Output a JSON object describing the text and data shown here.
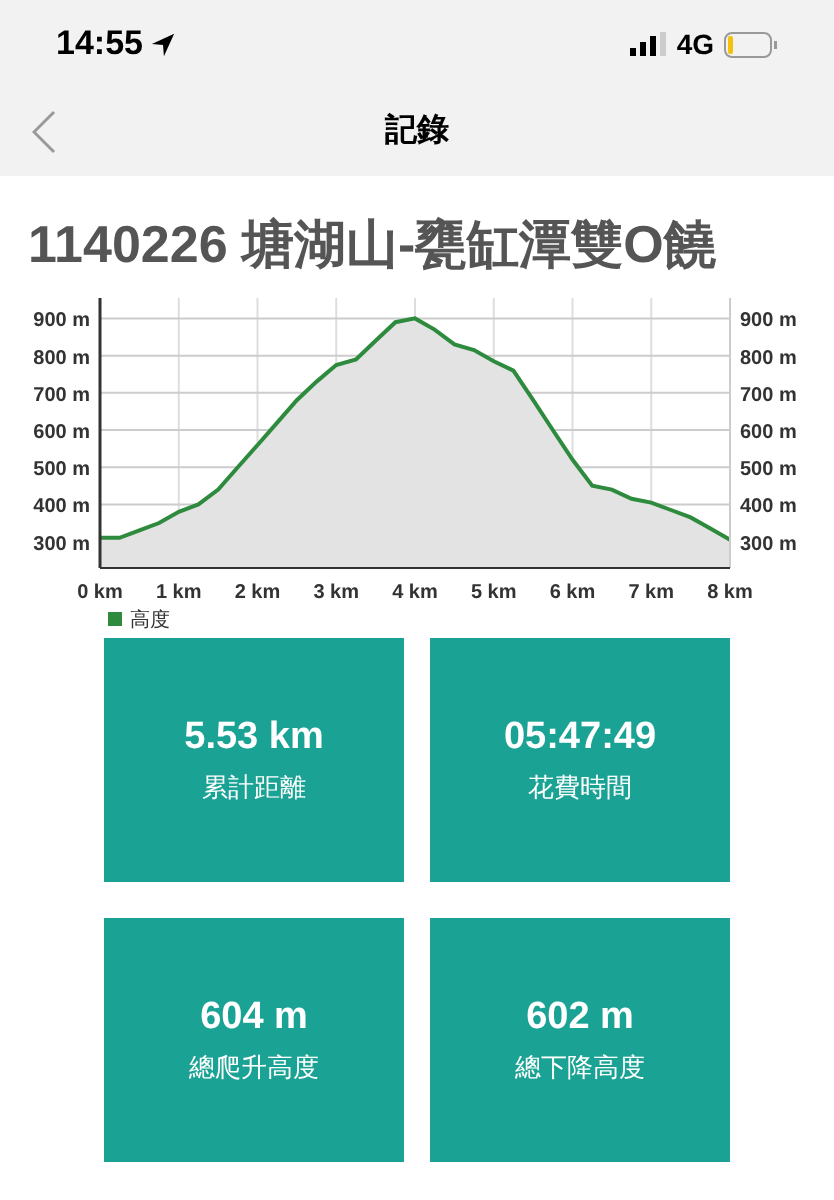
{
  "status_bar": {
    "time": "14:55",
    "network": "4G"
  },
  "nav": {
    "title": "記錄"
  },
  "heading": "1140226 塘湖山-甕缸潭雙O饒",
  "chart_data": {
    "type": "area",
    "x": [
      0,
      0.25,
      0.5,
      0.75,
      1,
      1.25,
      1.5,
      1.75,
      2,
      2.25,
      2.5,
      2.75,
      3,
      3.25,
      3.5,
      3.75,
      4,
      4.25,
      4.5,
      4.75,
      5,
      5.25,
      5.5,
      5.75,
      6,
      6.25,
      6.5,
      6.75,
      7,
      7.25,
      7.5,
      7.75,
      8
    ],
    "series": [
      {
        "name": "高度",
        "color": "#2e8b3e",
        "values": [
          310,
          310,
          330,
          350,
          380,
          400,
          440,
          500,
          560,
          620,
          680,
          730,
          775,
          790,
          840,
          890,
          900,
          870,
          830,
          815,
          785,
          760,
          680,
          600,
          520,
          450,
          440,
          415,
          405,
          385,
          365,
          335,
          305
        ]
      }
    ],
    "grid": true,
    "xlim": [
      0,
      8
    ],
    "ylim": [
      229,
      955
    ],
    "xticks": [
      {
        "value": 0,
        "label": "0 km"
      },
      {
        "value": 1,
        "label": "1 km"
      },
      {
        "value": 2,
        "label": "2 km"
      },
      {
        "value": 3,
        "label": "3 km"
      },
      {
        "value": 4,
        "label": "4 km"
      },
      {
        "value": 5,
        "label": "5 km"
      },
      {
        "value": 6,
        "label": "6 km"
      },
      {
        "value": 7,
        "label": "7 km"
      },
      {
        "value": 8,
        "label": "8 km"
      }
    ],
    "yticks": [
      {
        "value": 300,
        "label": "300 m"
      },
      {
        "value": 400,
        "label": "400 m"
      },
      {
        "value": 500,
        "label": "500 m"
      },
      {
        "value": 600,
        "label": "600 m"
      },
      {
        "value": 700,
        "label": "700 m"
      },
      {
        "value": 800,
        "label": "800 m"
      },
      {
        "value": 900,
        "label": "900 m"
      }
    ]
  },
  "stats": [
    {
      "value": "5.53 km",
      "label": "累計距離"
    },
    {
      "value": "05:47:49",
      "label": "花費時間"
    },
    {
      "value": "604 m",
      "label": "總爬升高度"
    },
    {
      "value": "602 m",
      "label": "總下降高度"
    }
  ]
}
